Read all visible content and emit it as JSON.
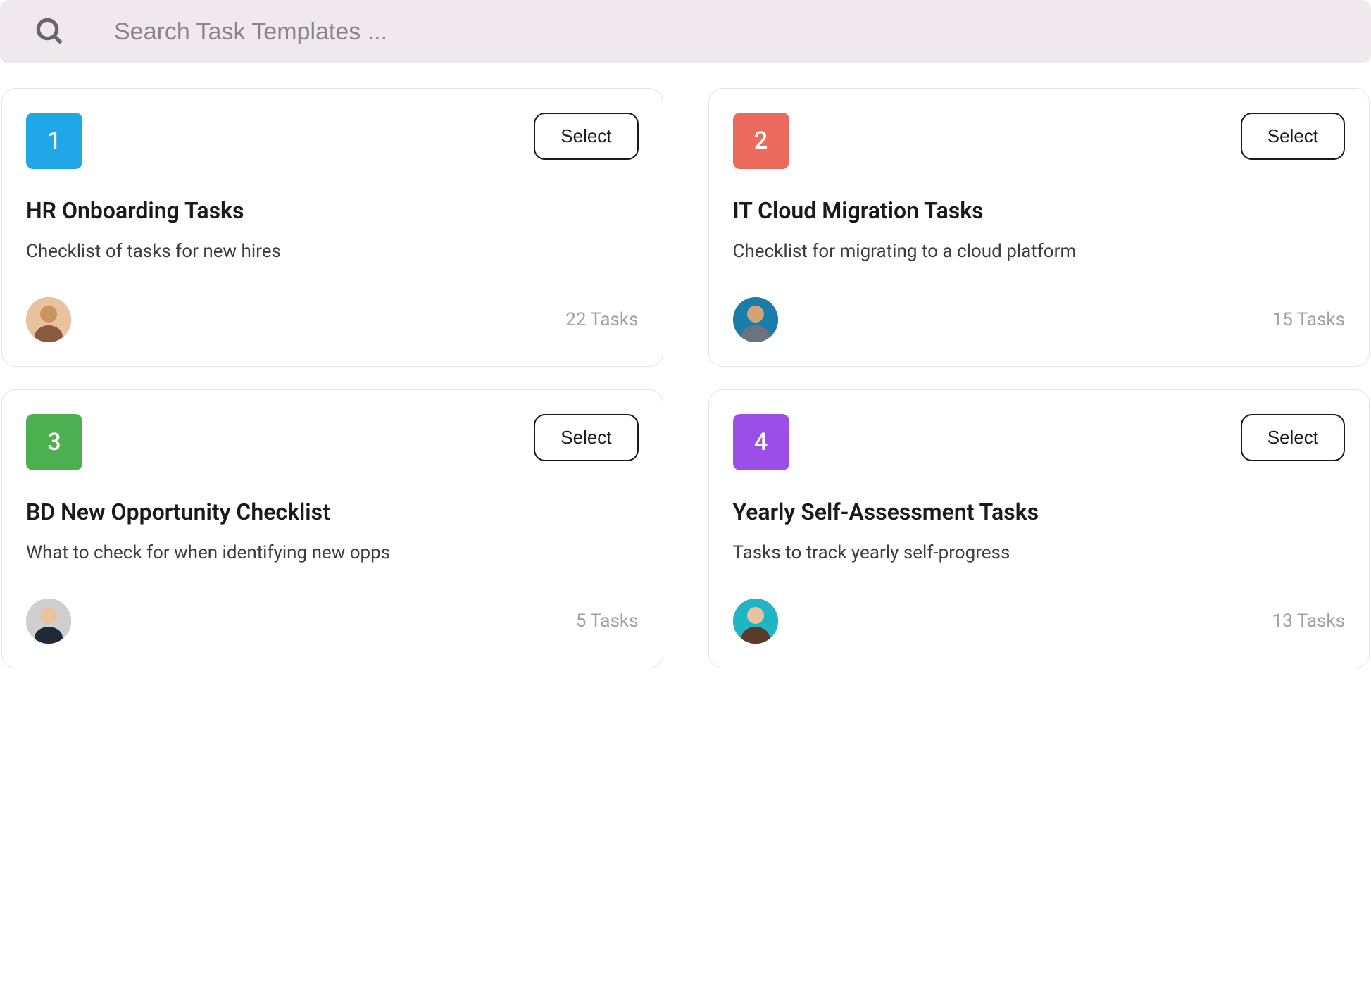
{
  "search": {
    "placeholder": "Search Task Templates ..."
  },
  "cards": [
    {
      "number": "1",
      "color": "#1fa7e8",
      "select_label": "Select",
      "title": "HR Onboarding Tasks",
      "description": "Checklist of tasks for new hires",
      "task_count": "22 Tasks",
      "avatar_bg": "#d9a876"
    },
    {
      "number": "2",
      "color": "#eb6a5b",
      "select_label": "Select",
      "title": "IT Cloud Migration Tasks",
      "description": "Checklist for migrating to a cloud platform",
      "task_count": "15 Tasks",
      "avatar_bg": "#1a7ca8"
    },
    {
      "number": "3",
      "color": "#4caf50",
      "select_label": "Select",
      "title": "BD New Opportunity Checklist",
      "description": "What to check for when identifying new opps",
      "task_count": "5 Tasks",
      "avatar_bg": "#2d4a5e"
    },
    {
      "number": "4",
      "color": "#9b4ee8",
      "select_label": "Select",
      "title": "Yearly Self-Assessment Tasks",
      "description": "Tasks to track yearly self-progress",
      "task_count": "13 Tasks",
      "avatar_bg": "#1fb5c4"
    }
  ]
}
